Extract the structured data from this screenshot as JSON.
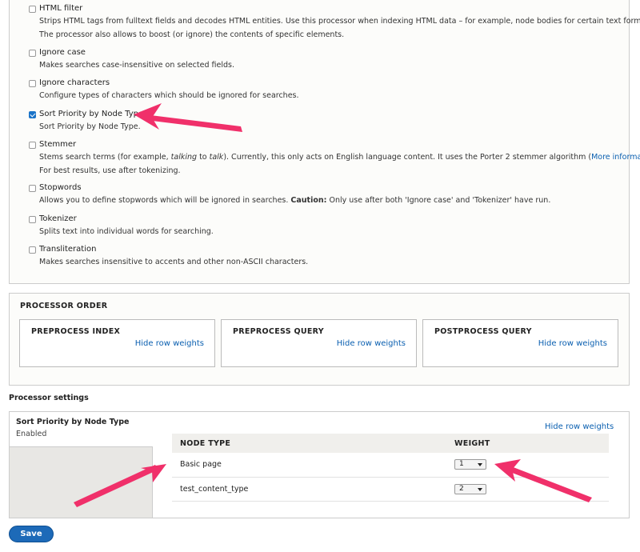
{
  "processors": [
    {
      "label": "HTML filter",
      "checked": false,
      "desc": [
        "Strips HTML tags from fulltext fields and decodes HTML entities. Use this processor when indexing HTML data – for example, node bodies for certain text formats.",
        "The processor also allows to boost (or ignore) the contents of specific elements."
      ]
    },
    {
      "label": "Ignore case",
      "checked": false,
      "desc": [
        "Makes searches case-insensitive on selected fields."
      ]
    },
    {
      "label": "Ignore characters",
      "checked": false,
      "desc": [
        "Configure types of characters which should be ignored for searches."
      ]
    },
    {
      "label": "Sort Priority by Node Type",
      "checked": true,
      "desc": [
        "Sort Priority by Node Type."
      ]
    },
    {
      "label": "Stemmer",
      "checked": false,
      "desc_parts": {
        "a": "Stems search terms (for example, ",
        "i1": "talking",
        "b": " to ",
        "i2": "talk",
        "c": "). Currently, this only acts on English language content. It uses the Porter 2 stemmer algorithm (",
        "link": "More information",
        "d": ")."
      },
      "desc2": "For best results, use after tokenizing."
    },
    {
      "label": "Stopwords",
      "checked": false,
      "desc_parts": {
        "a": "Allows you to define stopwords which will be ignored in searches. ",
        "bold": "Caution:",
        "b": " Only use after both 'Ignore case' and 'Tokenizer' have run."
      }
    },
    {
      "label": "Tokenizer",
      "checked": false,
      "desc": [
        "Splits text into individual words for searching."
      ]
    },
    {
      "label": "Transliteration",
      "checked": false,
      "desc": [
        "Makes searches insensitive to accents and other non-ASCII characters."
      ]
    }
  ],
  "processor_order": {
    "title": "PROCESSOR ORDER",
    "boxes": [
      {
        "title": "PREPROCESS INDEX",
        "link": "Hide row weights"
      },
      {
        "title": "PREPROCESS QUERY",
        "link": "Hide row weights"
      },
      {
        "title": "POSTPROCESS QUERY",
        "link": "Hide row weights"
      }
    ]
  },
  "processor_settings": {
    "label": "Processor settings",
    "tab": {
      "title": "Sort Priority by Node Type",
      "status": "Enabled"
    },
    "hide_link": "Hide row weights",
    "columns": [
      "NODE TYPE",
      "WEIGHT"
    ],
    "rows": [
      {
        "type": "Basic page",
        "weight": "1"
      },
      {
        "type": "test_content_type",
        "weight": "2"
      }
    ]
  },
  "save_label": "Save",
  "colors": {
    "accent": "#1d6ab8",
    "link": "#0a5fb0",
    "annotation_arrow": "#f0306a"
  }
}
